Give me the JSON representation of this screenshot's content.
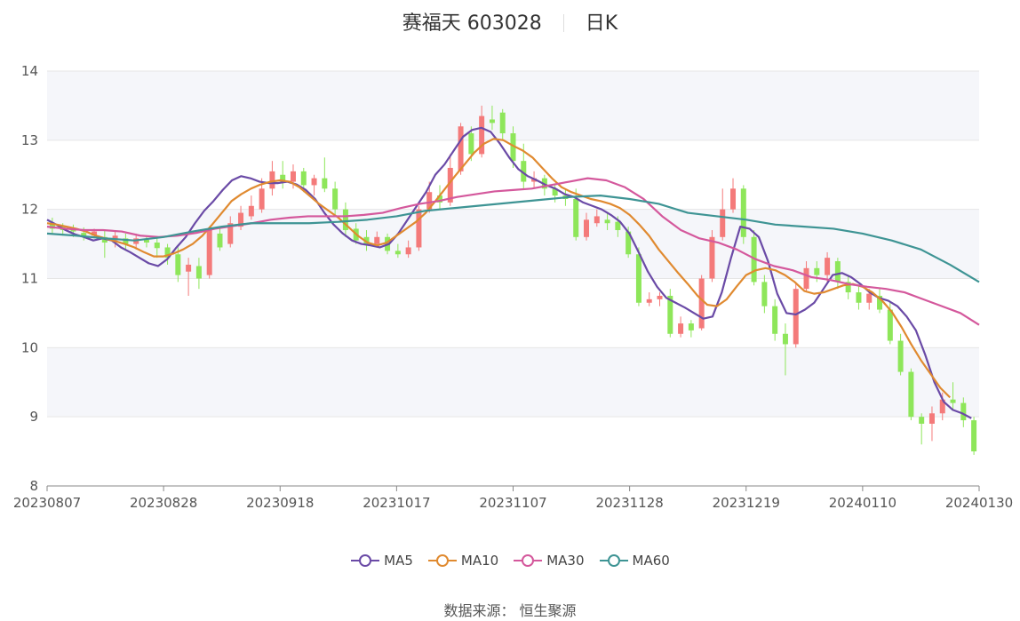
{
  "header": {
    "stock": "赛福天 603028",
    "period": "日K"
  },
  "source": {
    "label": "数据来源：",
    "name": "恒生聚源"
  },
  "colors": {
    "up": "#f47a7a",
    "down": "#8ee65a",
    "band": "#f5f6fa",
    "grid": "#e6e6e6",
    "axis": "#555555"
  },
  "chart_data": {
    "type": "line",
    "subtype": "candlestick_with_moving_averages",
    "ylim": [
      8,
      14
    ],
    "yticks": [
      8,
      9,
      10,
      11,
      12,
      13,
      14
    ],
    "xlabels": [
      "20230807",
      "20230828",
      "20230918",
      "20231017",
      "20231107",
      "20231128",
      "20231219",
      "20240110",
      "20240130"
    ],
    "grid": true,
    "legend_position": "bottom",
    "x_count": 120,
    "series": [
      {
        "name": "MA5",
        "color": "#6a4aa6",
        "values": [
          11.85,
          11.78,
          11.7,
          11.64,
          11.6,
          11.55,
          11.58,
          11.55,
          11.45,
          11.38,
          11.3,
          11.22,
          11.18,
          11.28,
          11.45,
          11.6,
          11.8,
          11.98,
          12.12,
          12.28,
          12.42,
          12.48,
          12.45,
          12.4,
          12.38,
          12.38,
          12.4,
          12.36,
          12.28,
          12.15,
          11.95,
          11.78,
          11.65,
          11.55,
          11.5,
          11.48,
          11.45,
          11.5,
          11.65,
          11.85,
          12.05,
          12.25,
          12.5,
          12.65,
          12.85,
          13.05,
          13.15,
          13.18,
          13.12,
          12.95,
          12.75,
          12.58,
          12.48,
          12.42,
          12.35,
          12.3,
          12.22,
          12.18,
          12.1,
          12.05,
          12,
          11.92,
          11.82,
          11.65,
          11.38,
          11.1,
          10.88,
          10.72,
          10.65,
          10.58,
          10.5,
          10.42,
          10.45,
          10.8,
          11.3,
          11.75,
          11.72,
          11.6,
          11.25,
          10.78,
          10.5,
          10.48,
          10.55,
          10.65,
          10.85,
          11.05,
          11.08,
          11.02,
          10.92,
          10.8,
          10.72,
          10.68,
          10.6,
          10.45,
          10.25,
          9.9,
          9.5,
          9.22,
          9.1,
          9.05,
          8.98
        ],
        "x_start": 0,
        "x_step": 1.19
      },
      {
        "name": "MA10",
        "color": "#e08a30",
        "values": [
          11.8,
          11.78,
          11.75,
          11.72,
          11.68,
          11.62,
          11.58,
          11.54,
          11.5,
          11.45,
          11.38,
          11.32,
          11.32,
          11.36,
          11.42,
          11.5,
          11.62,
          11.78,
          11.95,
          12.12,
          12.22,
          12.3,
          12.36,
          12.4,
          12.42,
          12.4,
          12.32,
          12.2,
          12.08,
          11.98,
          11.88,
          11.75,
          11.62,
          11.52,
          11.48,
          11.52,
          11.62,
          11.72,
          11.82,
          11.95,
          12.12,
          12.3,
          12.48,
          12.65,
          12.82,
          12.95,
          13.02,
          13,
          12.92,
          12.85,
          12.75,
          12.6,
          12.45,
          12.32,
          12.25,
          12.2,
          12.15,
          12.12,
          12.08,
          12.02,
          11.92,
          11.78,
          11.62,
          11.42,
          11.25,
          11.08,
          10.92,
          10.75,
          10.62,
          10.6,
          10.7,
          10.88,
          11.05,
          11.12,
          11.15,
          11.12,
          11.05,
          10.95,
          10.82,
          10.78,
          10.8,
          10.85,
          10.9,
          10.92,
          10.88,
          10.8,
          10.68,
          10.52,
          10.3,
          10.05,
          9.82,
          9.62,
          9.42,
          9.28
        ],
        "x_start": 0,
        "x_step": 1.25
      },
      {
        "name": "MA30",
        "color": "#d4589c",
        "values": [
          11.75,
          11.72,
          11.7,
          11.7,
          11.68,
          11.62,
          11.6,
          11.62,
          11.66,
          11.72,
          11.76,
          11.8,
          11.85,
          11.88,
          11.9,
          11.9,
          11.9,
          11.92,
          11.95,
          12.02,
          12.08,
          12.12,
          12.18,
          12.22,
          12.26,
          12.28,
          12.3,
          12.35,
          12.4,
          12.45,
          12.42,
          12.32,
          12.15,
          11.9,
          11.7,
          11.58,
          11.52,
          11.42,
          11.28,
          11.18,
          11.12,
          11.02,
          10.98,
          10.92,
          10.88,
          10.85,
          10.8,
          10.7,
          10.6,
          10.5,
          10.33
        ],
        "x_start": 0,
        "x_step": 2.4
      },
      {
        "name": "MA60",
        "color": "#3e9494",
        "values": [
          11.65,
          11.62,
          11.58,
          11.55,
          11.6,
          11.68,
          11.75,
          11.8,
          11.8,
          11.8,
          11.82,
          11.85,
          11.9,
          11.98,
          12.02,
          12.06,
          12.1,
          12.14,
          12.18,
          12.2,
          12.15,
          12.08,
          11.95,
          11.9,
          11.85,
          11.78,
          11.75,
          11.72,
          11.65,
          11.55,
          11.42,
          11.2,
          10.95
        ],
        "x_start": 0,
        "x_step": 3.75
      }
    ],
    "candles": [
      [
        11.8,
        11.72,
        11.88,
        11.65
      ],
      [
        11.75,
        11.7,
        11.8,
        11.62
      ],
      [
        11.72,
        11.68,
        11.78,
        11.6
      ],
      [
        11.66,
        11.62,
        11.74,
        11.55
      ],
      [
        11.62,
        11.68,
        11.72,
        11.58
      ],
      [
        11.6,
        11.52,
        11.7,
        11.3
      ],
      [
        11.55,
        11.62,
        11.7,
        11.45
      ],
      [
        11.58,
        11.5,
        11.65,
        11.4
      ],
      [
        11.5,
        11.58,
        11.65,
        11.42
      ],
      [
        11.56,
        11.52,
        11.62,
        11.45
      ],
      [
        11.52,
        11.44,
        11.6,
        11.3
      ],
      [
        11.45,
        11.3,
        11.5,
        11.2
      ],
      [
        11.35,
        11.05,
        11.45,
        10.95
      ],
      [
        11.1,
        11.2,
        11.3,
        10.75
      ],
      [
        11.18,
        11.0,
        11.3,
        10.85
      ],
      [
        11.05,
        11.7,
        11.75,
        11.0
      ],
      [
        11.65,
        11.45,
        11.75,
        11.4
      ],
      [
        11.5,
        11.8,
        11.9,
        11.45
      ],
      [
        11.75,
        11.95,
        12.05,
        11.7
      ],
      [
        11.9,
        12.05,
        12.2,
        11.85
      ],
      [
        12.0,
        12.3,
        12.45,
        11.95
      ],
      [
        12.3,
        12.55,
        12.7,
        12.2
      ],
      [
        12.5,
        12.4,
        12.7,
        12.3
      ],
      [
        12.4,
        12.55,
        12.65,
        12.3
      ],
      [
        12.55,
        12.35,
        12.6,
        12.25
      ],
      [
        12.35,
        12.45,
        12.5,
        12.2
      ],
      [
        12.45,
        12.3,
        12.75,
        12.25
      ],
      [
        12.3,
        12.0,
        12.4,
        11.9
      ],
      [
        12.0,
        11.7,
        12.1,
        11.6
      ],
      [
        11.72,
        11.55,
        11.8,
        11.5
      ],
      [
        11.6,
        11.5,
        11.7,
        11.4
      ],
      [
        11.5,
        11.6,
        11.68,
        11.45
      ],
      [
        11.6,
        11.4,
        11.65,
        11.35
      ],
      [
        11.4,
        11.35,
        11.5,
        11.3
      ],
      [
        11.35,
        11.45,
        11.55,
        11.3
      ],
      [
        11.45,
        12.0,
        12.05,
        11.4
      ],
      [
        12.0,
        12.25,
        12.4,
        11.95
      ],
      [
        12.2,
        12.1,
        12.35,
        12.0
      ],
      [
        12.1,
        12.6,
        12.8,
        12.05
      ],
      [
        12.55,
        13.2,
        13.25,
        12.5
      ],
      [
        13.1,
        12.8,
        13.2,
        12.7
      ],
      [
        12.8,
        13.35,
        13.5,
        12.75
      ],
      [
        13.3,
        13.25,
        13.5,
        13.15
      ],
      [
        13.4,
        13.1,
        13.45,
        13.0
      ],
      [
        13.1,
        12.7,
        13.2,
        12.6
      ],
      [
        12.7,
        12.4,
        12.95,
        12.3
      ],
      [
        12.4,
        12.45,
        12.55,
        12.3
      ],
      [
        12.45,
        12.3,
        12.5,
        12.2
      ],
      [
        12.3,
        12.2,
        12.35,
        12.1
      ],
      [
        12.2,
        12.15,
        12.3,
        12.05
      ],
      [
        12.15,
        11.6,
        12.3,
        11.55
      ],
      [
        11.6,
        11.85,
        11.95,
        11.55
      ],
      [
        11.8,
        11.9,
        12.0,
        11.75
      ],
      [
        11.85,
        11.8,
        11.95,
        11.7
      ],
      [
        11.82,
        11.7,
        11.9,
        11.6
      ],
      [
        11.68,
        11.35,
        11.75,
        11.3
      ],
      [
        11.35,
        10.65,
        11.45,
        10.6
      ],
      [
        10.65,
        10.7,
        10.8,
        10.6
      ],
      [
        10.7,
        10.75,
        10.8,
        10.6
      ],
      [
        10.75,
        10.2,
        10.85,
        10.15
      ],
      [
        10.2,
        10.35,
        10.45,
        10.15
      ],
      [
        10.35,
        10.25,
        10.4,
        10.15
      ],
      [
        10.28,
        11.0,
        11.05,
        10.25
      ],
      [
        11.0,
        11.6,
        11.7,
        10.95
      ],
      [
        11.6,
        12.0,
        12.3,
        11.55
      ],
      [
        12.0,
        12.3,
        12.45,
        11.95
      ],
      [
        12.3,
        11.6,
        12.35,
        11.5
      ],
      [
        11.6,
        10.95,
        11.7,
        10.9
      ],
      [
        10.95,
        10.6,
        11.05,
        10.5
      ],
      [
        10.6,
        10.2,
        10.7,
        10.1
      ],
      [
        10.2,
        10.05,
        10.35,
        9.6
      ],
      [
        10.05,
        10.85,
        10.95,
        10.0
      ],
      [
        10.85,
        11.15,
        11.25,
        10.8
      ],
      [
        11.15,
        11.05,
        11.25,
        10.95
      ],
      [
        11.05,
        11.3,
        11.38,
        10.95
      ],
      [
        11.25,
        10.95,
        11.3,
        10.85
      ],
      [
        10.95,
        10.8,
        11.05,
        10.7
      ],
      [
        10.8,
        10.65,
        10.9,
        10.55
      ],
      [
        10.65,
        10.78,
        10.85,
        10.55
      ],
      [
        10.75,
        10.55,
        10.85,
        10.5
      ],
      [
        10.55,
        10.1,
        10.65,
        10.05
      ],
      [
        10.1,
        9.65,
        10.2,
        9.6
      ],
      [
        9.65,
        9.0,
        9.7,
        8.95
      ],
      [
        9.0,
        8.9,
        9.05,
        8.6
      ],
      [
        8.9,
        9.05,
        9.15,
        8.65
      ],
      [
        9.05,
        9.25,
        9.35,
        8.95
      ],
      [
        9.25,
        9.2,
        9.5,
        9.1
      ],
      [
        9.2,
        8.95,
        9.28,
        8.85
      ],
      [
        8.95,
        8.5,
        9.0,
        8.45
      ]
    ]
  }
}
